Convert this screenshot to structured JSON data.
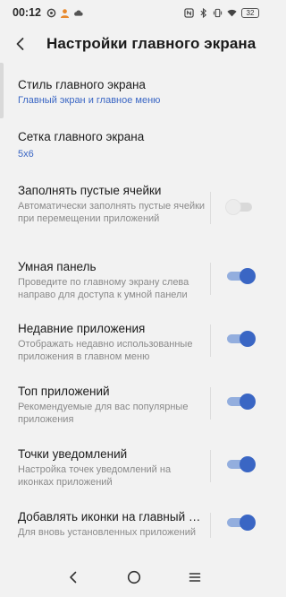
{
  "status_bar": {
    "time": "00:12",
    "battery": "32",
    "icons_left": [
      "settings-icon",
      "avatar-icon",
      "cloud-icon"
    ],
    "icons_right": [
      "nfc-icon",
      "bluetooth-icon",
      "vibrate-icon",
      "wifi-icon",
      "battery-icon"
    ]
  },
  "header": {
    "title": "Настройки главного экрана",
    "back_icon": "arrow-left-icon"
  },
  "settings": [
    {
      "title": "Стиль главного экрана",
      "value": "Главный экран и главное меню"
    },
    {
      "title": "Сетка главного экрана",
      "value": "5x6"
    },
    {
      "title": "Заполнять пустые ячейки",
      "subtitle": "Автоматически заполнять пустые ячейки при перемещении приложений",
      "enabled": false
    },
    {
      "title": "Умная панель",
      "subtitle": "Проведите по главному экрану слева направо для доступа к умной панели",
      "enabled": true
    },
    {
      "title": "Недавние приложения",
      "subtitle": "Отображать недавно использованные приложения в главном меню",
      "enabled": true
    },
    {
      "title": "Топ приложений",
      "subtitle": "Рекомендуемые для вас популярные приложения",
      "enabled": true
    },
    {
      "title": "Точки уведомлений",
      "subtitle": "Настройка точек уведомлений на иконках приложений",
      "enabled": true
    },
    {
      "title": "Добавлять иконки на главный экран",
      "subtitle": "Для вновь установленных приложений",
      "enabled": true
    }
  ],
  "colors": {
    "accent": "#3a66c4",
    "accent_track": "#93aede",
    "background": "#f2f2f2",
    "secondary_text": "#8a8a8a"
  },
  "nav_bar": [
    "back-icon",
    "home-icon",
    "recents-icon"
  ]
}
